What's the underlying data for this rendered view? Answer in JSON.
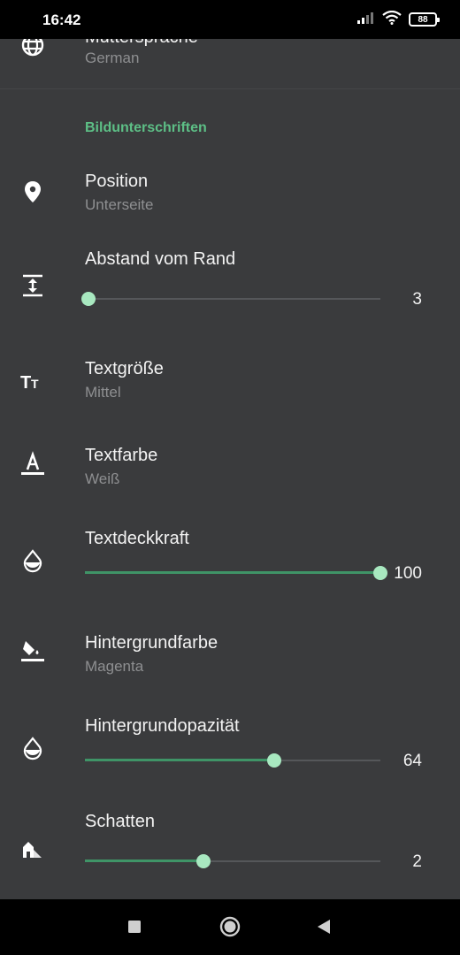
{
  "status_bar": {
    "time": "16:42",
    "battery": "88",
    "icons": [
      "signal-icon",
      "wifi-icon",
      "battery-icon"
    ]
  },
  "colors": {
    "background": "#3a3b3d",
    "accent": "#5dbf86",
    "slider_fill": "#3f9467",
    "slider_thumb": "#a8e8c0"
  },
  "top_item": {
    "title": "Muttersprache",
    "summary": "German",
    "icon": "globe-icon"
  },
  "section": {
    "header": "Bildunterschriften"
  },
  "items": {
    "position": {
      "title": "Position",
      "summary": "Unterseite",
      "icon": "location-pin-icon"
    },
    "edge_distance": {
      "title": "Abstand vom Rand",
      "value": "3",
      "fraction": 0.0,
      "icon": "vertical-spacing-icon"
    },
    "text_size": {
      "title": "Textgröße",
      "summary": "Mittel",
      "icon": "text-size-icon"
    },
    "text_color": {
      "title": "Textfarbe",
      "summary": "Weiß",
      "icon": "text-color-icon"
    },
    "text_opacity": {
      "title": "Textdeckkraft",
      "value": "100",
      "fraction": 1.0,
      "icon": "opacity-drop-icon"
    },
    "bg_color": {
      "title": "Hintergrundfarbe",
      "summary": "Magenta",
      "icon": "paint-bucket-icon"
    },
    "bg_opacity": {
      "title": "Hintergrundopazität",
      "value": "64",
      "fraction": 0.64,
      "icon": "opacity-drop-icon"
    },
    "shadow": {
      "title": "Schatten",
      "value": "2",
      "fraction": 0.4,
      "icon": "shadow-icon"
    }
  },
  "nav_bar": {
    "buttons": [
      "recents-square-icon",
      "home-circle-icon",
      "back-triangle-icon"
    ]
  }
}
